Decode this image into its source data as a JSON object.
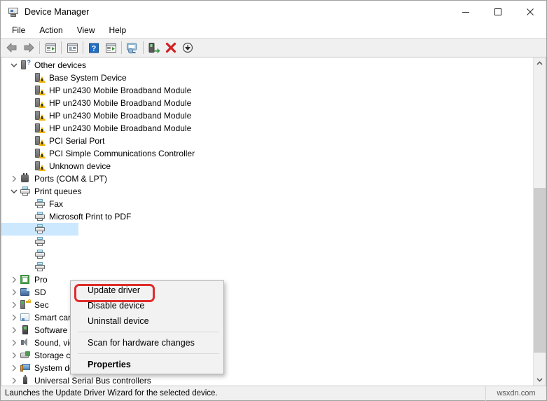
{
  "window": {
    "title": "Device Manager",
    "icon": "device-manager-icon",
    "controls": {
      "minimize": "minimize-icon",
      "maximize": "maximize-icon",
      "close": "close-icon"
    }
  },
  "menubar": {
    "items": [
      {
        "label": "File"
      },
      {
        "label": "Action"
      },
      {
        "label": "View"
      },
      {
        "label": "Help"
      }
    ]
  },
  "toolbar": {
    "buttons": [
      {
        "name": "back-icon",
        "tip": "Back"
      },
      {
        "name": "forward-icon",
        "tip": "Forward"
      },
      {
        "sep": true
      },
      {
        "name": "show-hide-console-tree-icon",
        "tip": "Show/Hide Console Tree"
      },
      {
        "sep": true
      },
      {
        "name": "properties-icon",
        "tip": "Properties"
      },
      {
        "sep": true
      },
      {
        "name": "help-icon",
        "tip": "Help"
      },
      {
        "name": "show-hide-action-pane-icon",
        "tip": "Show/Hide Action Pane"
      },
      {
        "sep": true
      },
      {
        "name": "scan-for-hardware-changes-icon",
        "tip": "Scan for hardware changes"
      },
      {
        "sep": true
      },
      {
        "name": "update-driver-icon",
        "tip": "Update driver"
      },
      {
        "name": "uninstall-device-icon",
        "tip": "Uninstall device"
      },
      {
        "name": "disable-device-icon",
        "tip": "Disable device"
      }
    ]
  },
  "tree": {
    "rows": [
      {
        "label": "Other devices",
        "indent": 0,
        "twisty": "expanded",
        "icon": "unknown-device-icon"
      },
      {
        "label": "Base System Device",
        "indent": 1,
        "twisty": "none",
        "icon": "warning-device-icon"
      },
      {
        "label": "HP un2430 Mobile Broadband Module",
        "indent": 1,
        "twisty": "none",
        "icon": "warning-device-icon"
      },
      {
        "label": "HP un2430 Mobile Broadband Module",
        "indent": 1,
        "twisty": "none",
        "icon": "warning-device-icon"
      },
      {
        "label": "HP un2430 Mobile Broadband Module",
        "indent": 1,
        "twisty": "none",
        "icon": "warning-device-icon"
      },
      {
        "label": "HP un2430 Mobile Broadband Module",
        "indent": 1,
        "twisty": "none",
        "icon": "warning-device-icon"
      },
      {
        "label": "PCI Serial Port",
        "indent": 1,
        "twisty": "none",
        "icon": "warning-device-icon"
      },
      {
        "label": "PCI Simple Communications Controller",
        "indent": 1,
        "twisty": "none",
        "icon": "warning-device-icon"
      },
      {
        "label": "Unknown device",
        "indent": 1,
        "twisty": "none",
        "icon": "warning-device-icon"
      },
      {
        "label": "Ports (COM & LPT)",
        "indent": 0,
        "twisty": "collapsed",
        "icon": "port-icon"
      },
      {
        "label": "Print queues",
        "indent": 0,
        "twisty": "expanded",
        "icon": "printer-icon"
      },
      {
        "label": "Fax",
        "indent": 1,
        "twisty": "none",
        "icon": "printer-icon"
      },
      {
        "label": "Microsoft Print to PDF",
        "indent": 1,
        "twisty": "none",
        "icon": "printer-icon"
      },
      {
        "label": "",
        "indent": 1,
        "twisty": "none",
        "icon": "printer-icon",
        "selected": true
      },
      {
        "label": "",
        "indent": 1,
        "twisty": "none",
        "icon": "printer-icon"
      },
      {
        "label": "",
        "indent": 1,
        "twisty": "none",
        "icon": "printer-icon"
      },
      {
        "label": "",
        "indent": 1,
        "twisty": "none",
        "icon": "printer-icon"
      },
      {
        "label": "Pro",
        "indent": 0,
        "twisty": "collapsed",
        "icon": "processor-icon"
      },
      {
        "label": "SD ",
        "indent": 0,
        "twisty": "collapsed",
        "icon": "sd-host-adapter-icon"
      },
      {
        "label": "Sec",
        "indent": 0,
        "twisty": "collapsed",
        "icon": "security-device-icon"
      },
      {
        "label": "Smart card readers",
        "indent": 0,
        "twisty": "collapsed",
        "icon": "smart-card-reader-icon"
      },
      {
        "label": "Software devices",
        "indent": 0,
        "twisty": "collapsed",
        "icon": "software-device-icon"
      },
      {
        "label": "Sound, video and game controllers",
        "indent": 0,
        "twisty": "collapsed",
        "icon": "sound-icon"
      },
      {
        "label": "Storage controllers",
        "indent": 0,
        "twisty": "collapsed",
        "icon": "storage-controller-icon"
      },
      {
        "label": "System devices",
        "indent": 0,
        "twisty": "collapsed",
        "icon": "system-device-icon"
      },
      {
        "label": "Universal Serial Bus controllers",
        "indent": 0,
        "twisty": "collapsed",
        "icon": "usb-controller-icon"
      }
    ]
  },
  "context_menu": {
    "highlight_color": "#e02b2b",
    "highlighted_item": "Update driver",
    "items": [
      {
        "label": "Update driver",
        "bold": false,
        "sep_after": false
      },
      {
        "label": "Disable device",
        "bold": false,
        "sep_after": false
      },
      {
        "label": "Uninstall device",
        "bold": false,
        "sep_after": true
      },
      {
        "label": "Scan for hardware changes",
        "bold": false,
        "sep_after": true
      },
      {
        "label": "Properties",
        "bold": true,
        "sep_after": false
      }
    ]
  },
  "scrollbar": {
    "up_arrow": "chevron-up-icon",
    "down_arrow": "chevron-down-icon",
    "thumb_top_pct": 39,
    "thumb_height_pct": 54
  },
  "statusbar": {
    "message": "Launches the Update Driver Wizard for the selected device.",
    "watermark": "wsxdn.com"
  }
}
